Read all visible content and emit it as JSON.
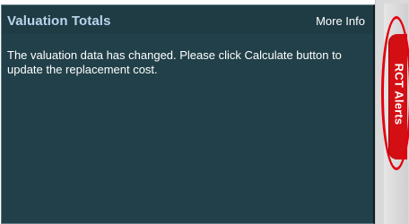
{
  "panel": {
    "title": "Valuation Totals",
    "more_info_label": "More Info",
    "message": "The valuation data has changed. Please click Calculate button to update the replacement cost."
  },
  "side_tab": {
    "label": "RCT Alerts",
    "color": "#d40f13"
  },
  "colors": {
    "panel_bg": "#214049",
    "title_text": "#b9d4ec"
  }
}
